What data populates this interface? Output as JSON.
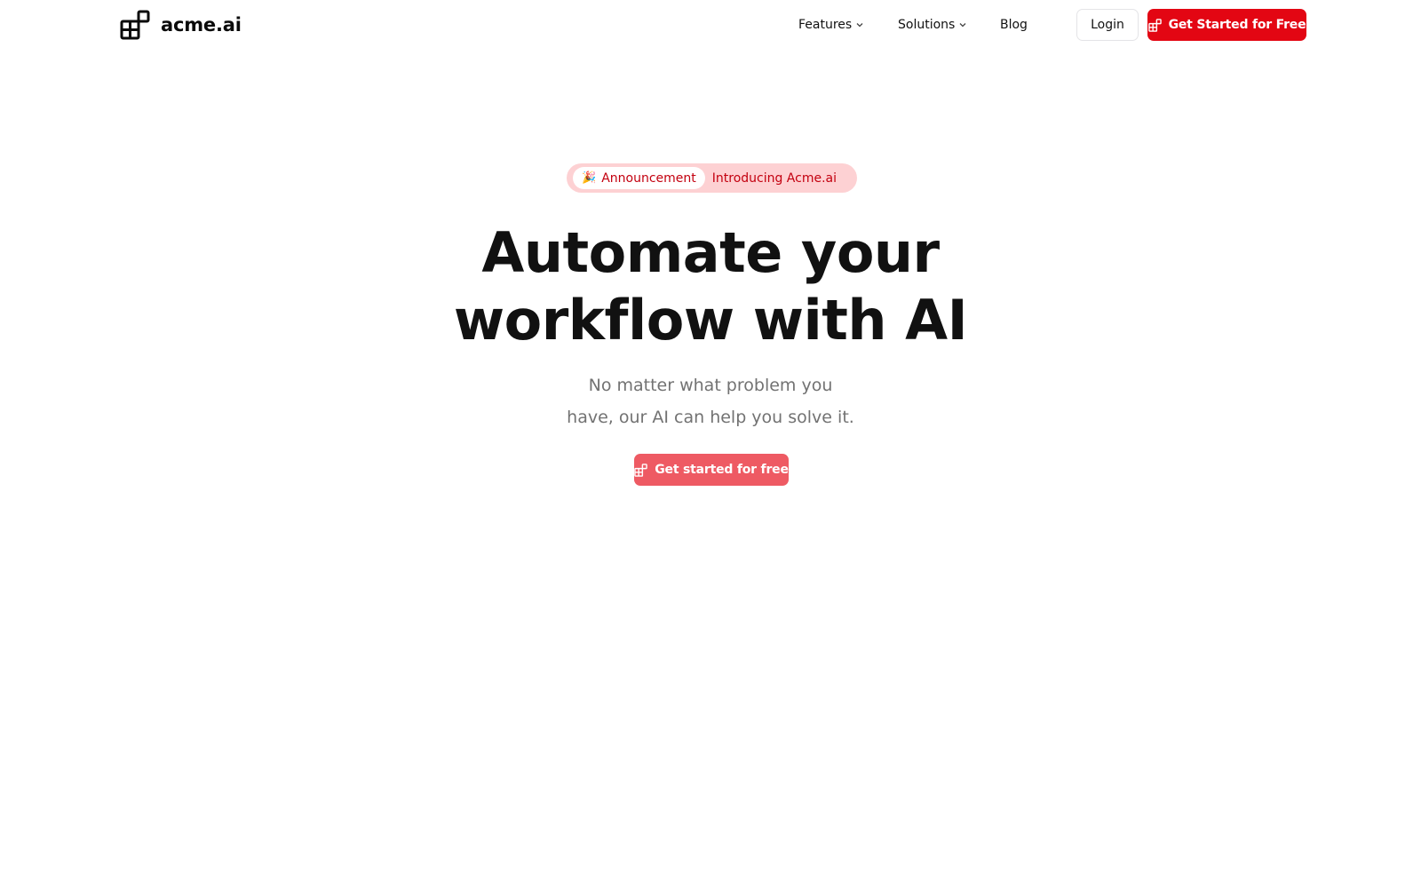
{
  "navbar": {
    "brand": {
      "name": "acme.ai",
      "logo_icon": "blocks-logo-icon"
    },
    "links": [
      {
        "label": "Features",
        "has_dropdown": true
      },
      {
        "label": "Solutions",
        "has_dropdown": true
      },
      {
        "label": "Blog",
        "has_dropdown": false
      }
    ],
    "login_label": "Login",
    "cta_label": "Get Started for Free",
    "cta_icon": "blocks-icon"
  },
  "hero": {
    "announcement": {
      "emoji": "🎉",
      "badge_label": "Announcement",
      "text": "Introducing Acme.ai"
    },
    "title_line1": "Automate your",
    "title_line2": "workflow with AI",
    "subtitle_line1": "No matter what problem you",
    "subtitle_line2": "have, our AI can help you solve it.",
    "cta_label": "Get started for free",
    "cta_icon": "blocks-icon"
  },
  "colors": {
    "primary": "#e30613",
    "hero_cta": "#ee5a63",
    "announcement_bg": "#fdd1d3",
    "announcement_text": "#c3000f",
    "subtitle_text": "#727272"
  }
}
